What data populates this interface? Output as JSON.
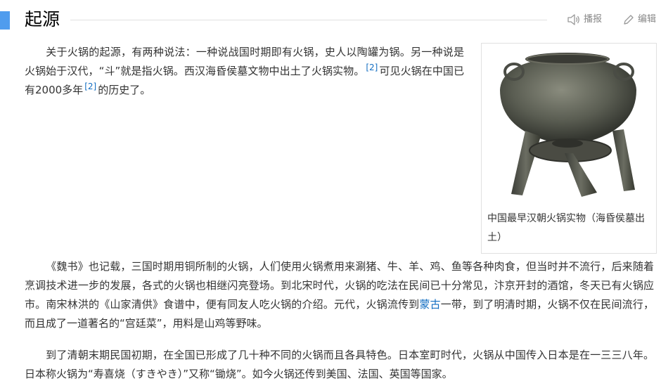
{
  "section": {
    "title": "起源",
    "tools": {
      "play_label": "播报",
      "edit_label": "编辑"
    }
  },
  "paragraph1": {
    "text_a": "关于火锅的起源，有两种说法：一种说战国时期即有火锅，史人以陶罐为锅。另一种说是火锅始于汉代，“斗”就是指火锅。西汉海昏侯墓文物中出土了火锅实物。",
    "ref_a": "[2]",
    "text_b": "可见火锅在中国已有2000多年",
    "ref_b": "[2]",
    "text_c": "的历史了。"
  },
  "figure": {
    "caption": "中国最早汉朝火锅实物（海昏侯墓出土）",
    "image_alt": "bronze-hotpot-photo"
  },
  "paragraph2": {
    "text_a": "《魏书》也记载，三国时期用铜所制的火锅，人们使用火锅煮用来涮猪、牛、羊、鸡、鱼等各种肉食，但当时并不流行，后来随着烹调技术进一步的发展，各式的火锅也相继闪亮登场。到北宋时代，火锅的吃法在民间已十分常见，汴京开封的酒馆，冬天已有火锅应市。南宋林洪的《山家清供》食谱中，便有同友人吃火锅的介绍。元代，火锅流传到",
    "link": "蒙古",
    "text_b": "一带，到了明清时期，火锅不仅在民间流行，而且成了一道著名的“宫廷菜”，用料是山鸡等野味。"
  },
  "paragraph3": {
    "text": "到了清朝末期民国初期，在全国已形成了几十种不同的火锅而且各具特色。日本室町时代，火锅从中国传入日本是在一三三八年。日本称火锅为“寿喜烧（すきやき）”又称“锄烧”。如今火锅还传到美国、法国、英国等国家。"
  },
  "colors": {
    "accent_bar": "#4f9cee",
    "link": "#136ec2",
    "text": "#333333"
  }
}
